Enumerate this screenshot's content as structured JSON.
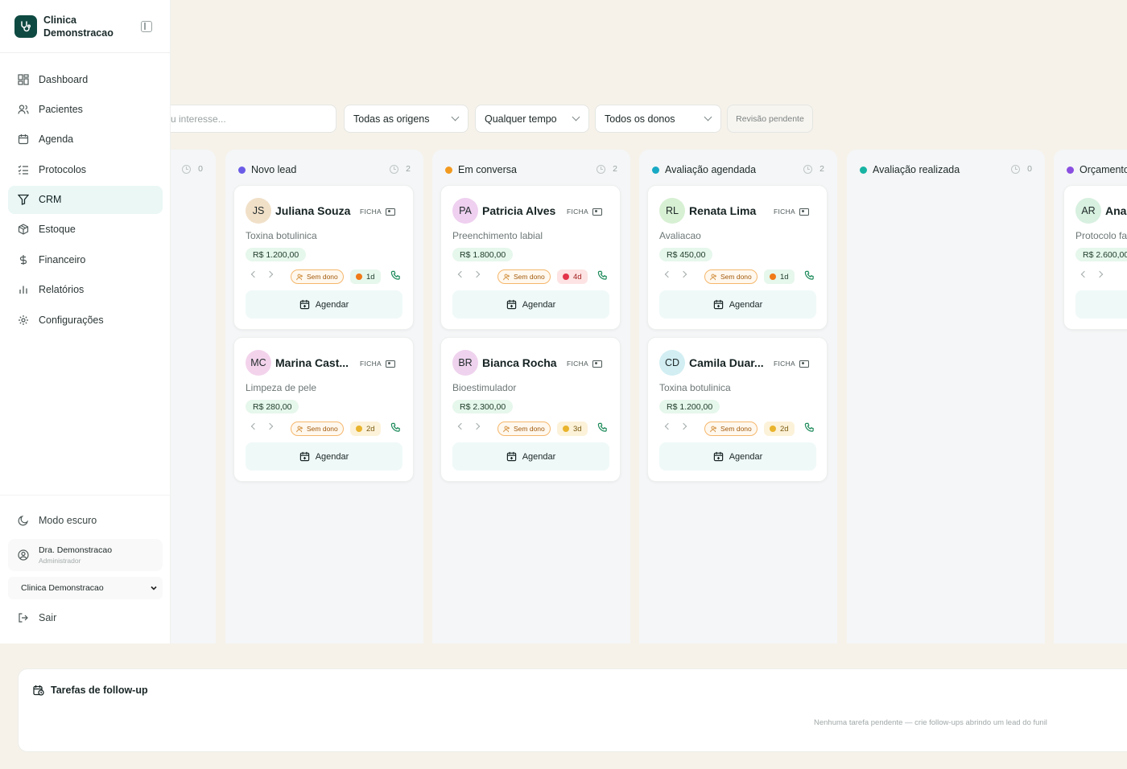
{
  "brand": {
    "name": "Clinica Demonstracao"
  },
  "nav": [
    {
      "label": "Dashboard",
      "icon": "dashboard-icon"
    },
    {
      "label": "Pacientes",
      "icon": "users-icon"
    },
    {
      "label": "Agenda",
      "icon": "calendar-icon"
    },
    {
      "label": "Protocolos",
      "icon": "list-check-icon"
    },
    {
      "label": "CRM",
      "icon": "funnel-icon",
      "active": true
    },
    {
      "label": "Estoque",
      "icon": "box-icon"
    },
    {
      "label": "Financeiro",
      "icon": "dollar-icon"
    },
    {
      "label": "Relatórios",
      "icon": "bar-chart-icon"
    },
    {
      "label": "Configurações",
      "icon": "gear-icon"
    }
  ],
  "sidebar_bottom": {
    "dark_mode": "Modo escuro",
    "user_name": "Dra. Demonstracao",
    "user_role": "Administrador",
    "clinic": "Clinica Demonstracao",
    "logout": "Sair"
  },
  "filters": {
    "search_placeholder": "u interesse...",
    "origin": "Todas as origens",
    "time": "Qualquer tempo",
    "owners": "Todos os donos",
    "review": "Revisão pendente"
  },
  "columns": [
    {
      "title": "",
      "count": "0",
      "color": ""
    },
    {
      "title": "Novo lead",
      "count": "2",
      "color": "#6b5ce7"
    },
    {
      "title": "Em conversa",
      "count": "2",
      "color": "#f29a1f"
    },
    {
      "title": "Avaliação agendada",
      "count": "2",
      "color": "#18a9c4"
    },
    {
      "title": "Avaliação realizada",
      "count": "0",
      "color": "#17b3a3"
    },
    {
      "title": "Orçamento",
      "count": "",
      "color": "#8a4fe0"
    }
  ],
  "cards": [
    {
      "initials": "JS",
      "name": "Juliana Souza",
      "procedure": "Toxina botulinica",
      "price": "R$ 1.200,00",
      "owner": "Sem dono",
      "age": "1d",
      "age_kind": "fire",
      "avatar_color": "#f1e0c8"
    },
    {
      "initials": "MC",
      "name": "Marina Cast...",
      "procedure": "Limpeza de pele",
      "price": "R$ 280,00",
      "owner": "Sem dono",
      "age": "2d",
      "age_kind": "warm",
      "avatar_color": "#f3d3ec"
    },
    {
      "initials": "PA",
      "name": "Patricia Alves",
      "procedure": "Preenchimento labial",
      "price": "R$ 1.800,00",
      "owner": "Sem dono",
      "age": "4d",
      "age_kind": "hot",
      "avatar_color": "#efd0f0"
    },
    {
      "initials": "BR",
      "name": "Bianca Rocha",
      "procedure": "Bioestimulador",
      "price": "R$ 2.300,00",
      "owner": "Sem dono",
      "age": "3d",
      "age_kind": "warm",
      "avatar_color": "#efd3ee"
    },
    {
      "initials": "RL",
      "name": "Renata Lima",
      "procedure": "Avaliacao",
      "price": "R$ 450,00",
      "owner": "Sem dono",
      "age": "1d",
      "age_kind": "fire",
      "avatar_color": "#d7f0d3"
    },
    {
      "initials": "CD",
      "name": "Camila Duar...",
      "procedure": "Toxina botulinica",
      "price": "R$ 1.200,00",
      "owner": "Sem dono",
      "age": "2d",
      "age_kind": "warm",
      "avatar_color": "#d2eef3"
    },
    {
      "initials": "AR",
      "name": "Ana",
      "procedure": "Protocolo fa",
      "price": "R$ 2.600,00",
      "owner": "",
      "age": "",
      "age_kind": "",
      "avatar_color": "#d7f0e0"
    }
  ],
  "card_labels": {
    "ficha": "FICHA",
    "agendar": "Agendar"
  },
  "followup": {
    "title": "Tarefas de follow-up",
    "empty": "Nenhuma tarefa pendente — crie follow-ups abrindo um lead do funil"
  },
  "colors": {
    "brand": "#0f4a42",
    "accent": "#eaf7f5",
    "price_bg": "#e6f7ec",
    "owner_border": "#f5b76c"
  }
}
